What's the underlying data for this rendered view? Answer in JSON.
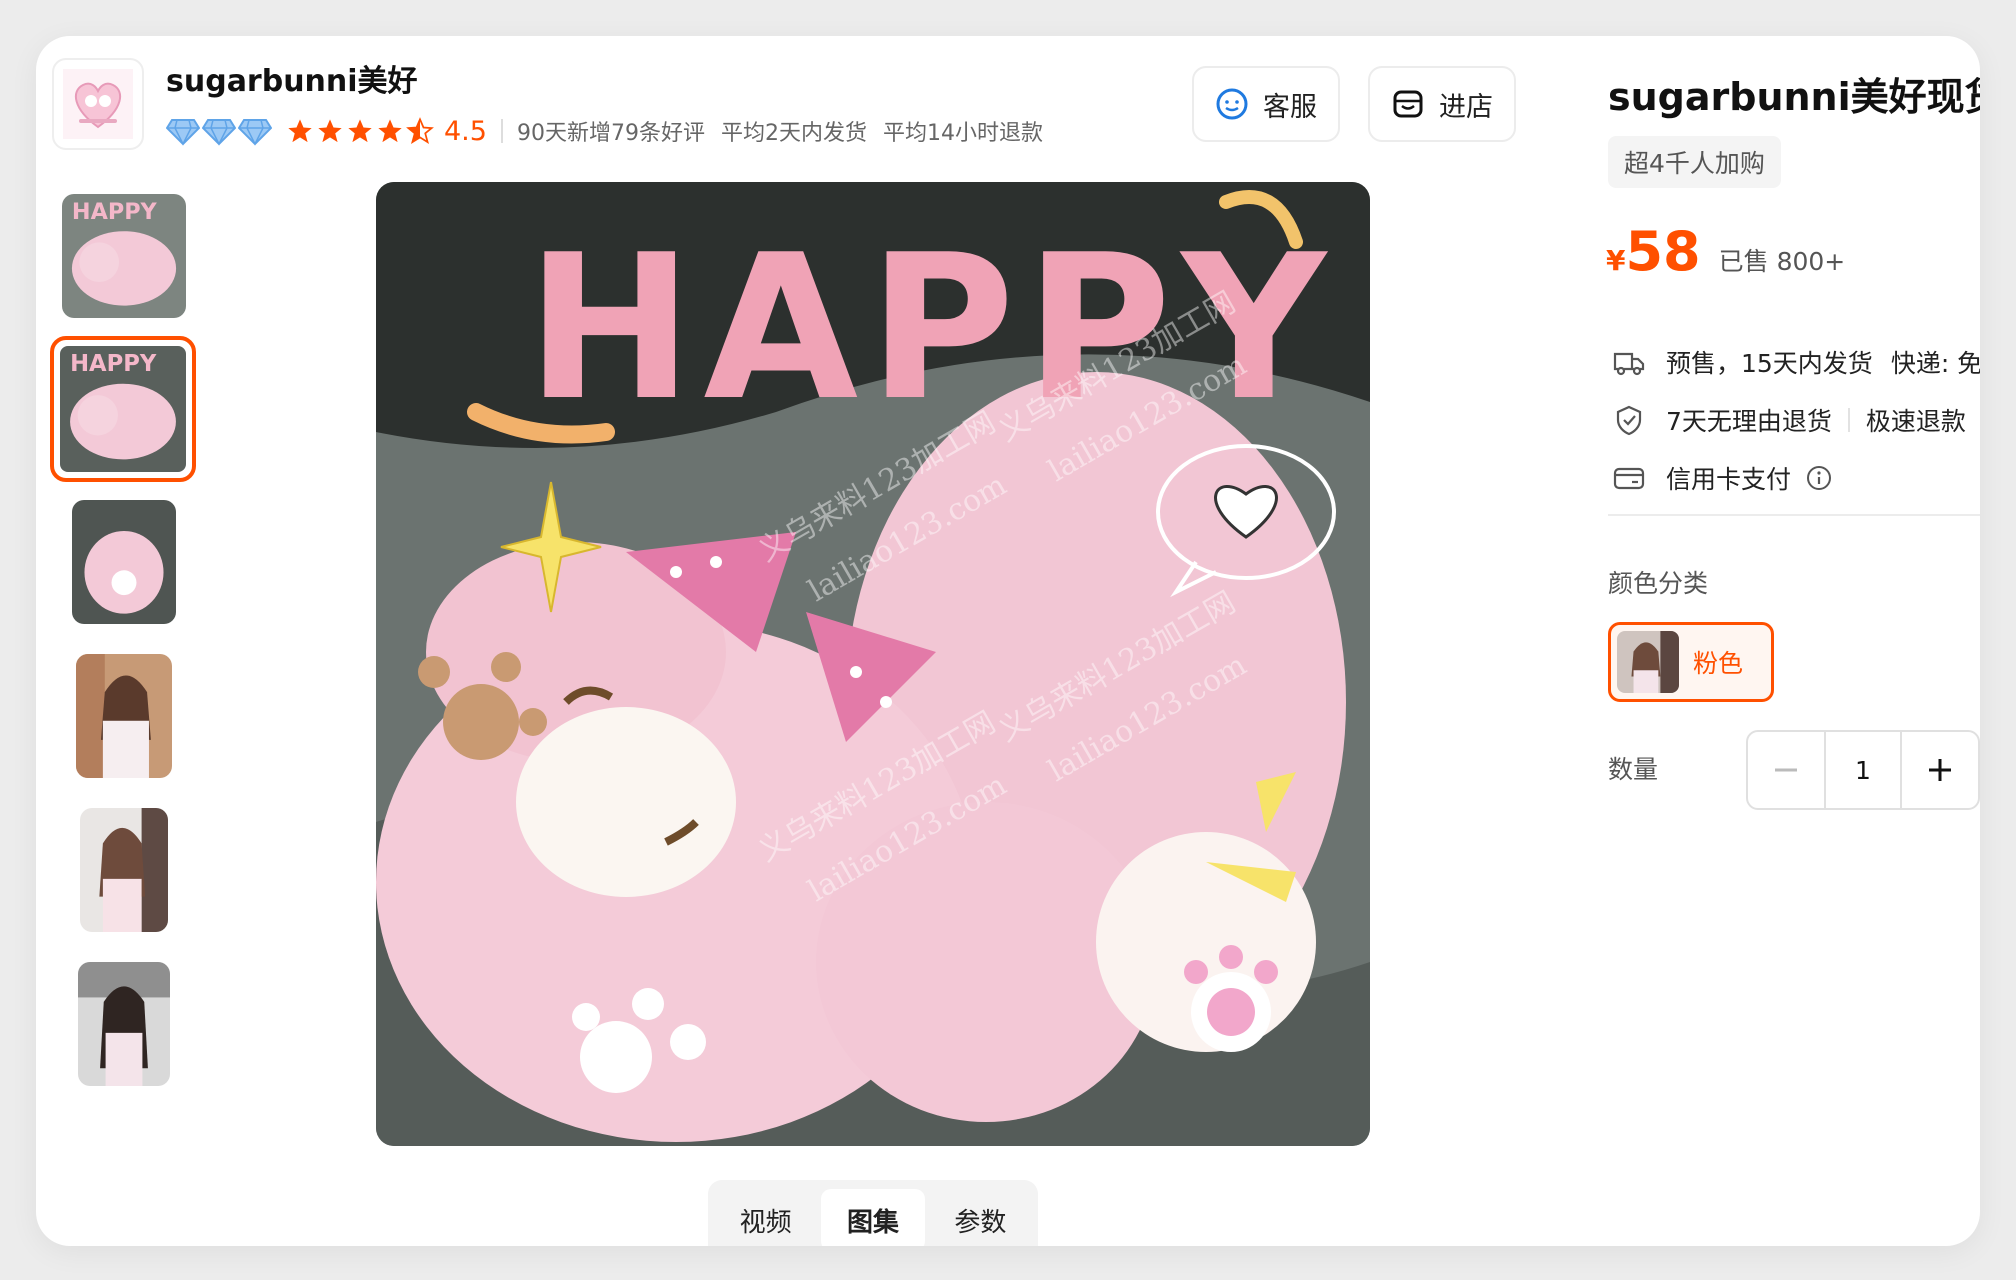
{
  "store": {
    "name": "sugarbunni美好",
    "rating": "4.5",
    "stats": [
      "90天新增79条好评",
      "平均2天内发货",
      "平均14小时退款"
    ],
    "service_label": "客服",
    "enter_store_label": "进店"
  },
  "media_tabs": [
    {
      "label": "视频",
      "active": false
    },
    {
      "label": "图集",
      "active": true
    },
    {
      "label": "参数",
      "active": false
    }
  ],
  "main_image": {
    "headline": "HAPPY"
  },
  "product": {
    "title": "sugarbunni美好现货甜",
    "tag": "超4千人加购",
    "currency": "¥",
    "price": "58",
    "sold": "已售 800+",
    "shipping_text": "预售，15天内发货",
    "shipping_extra": "快递: 免",
    "return_text": "7天无理由退货",
    "refund_text": "极速退款",
    "payment_text": "信用卡支付"
  },
  "options": {
    "color_label": "颜色分类",
    "selected_color": "粉色",
    "quantity_label": "数量",
    "quantity": "1"
  },
  "colors": {
    "accent": "#ff5000"
  }
}
